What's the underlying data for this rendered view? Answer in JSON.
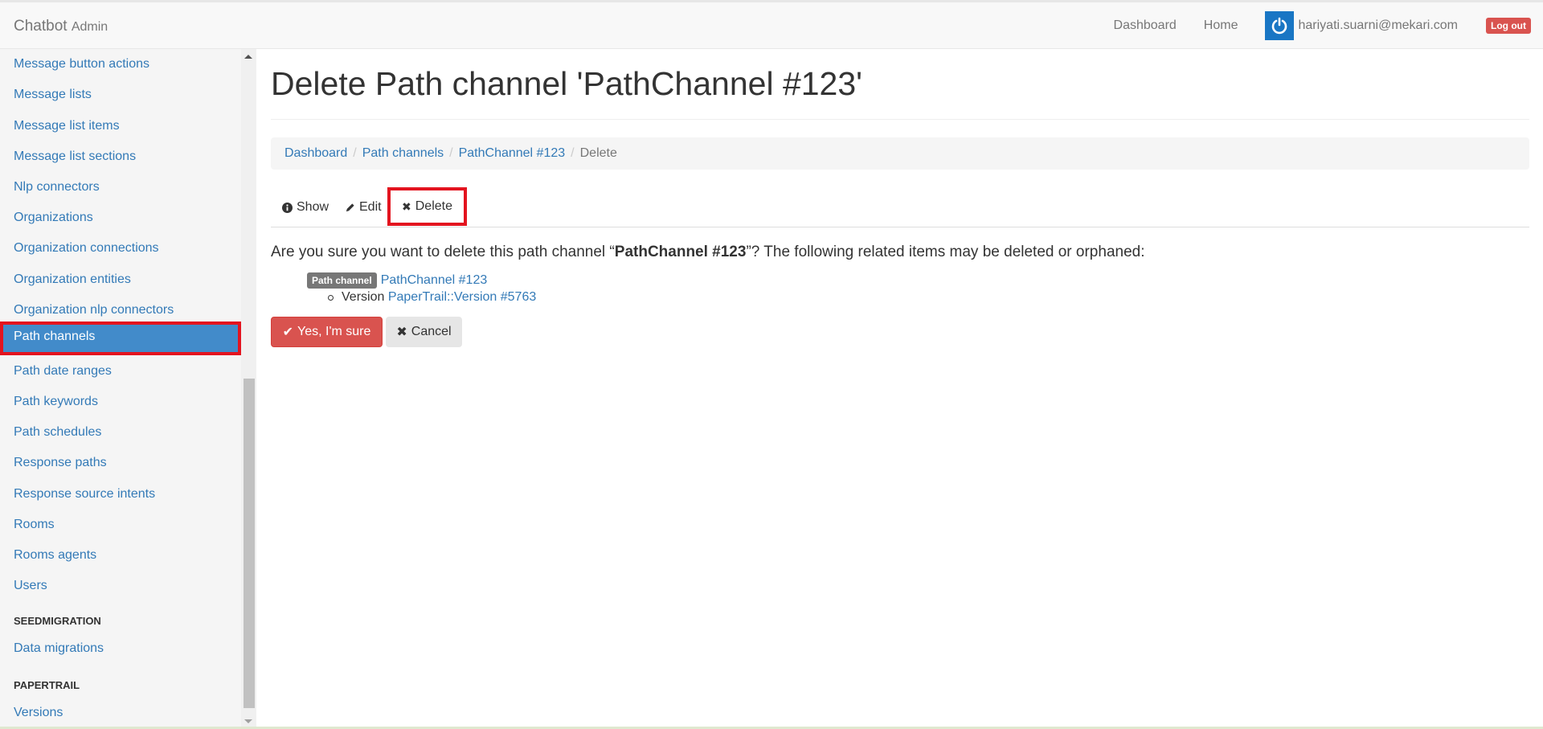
{
  "brand": {
    "name": "Chatbot",
    "sub": "Admin"
  },
  "nav": {
    "dashboard": "Dashboard",
    "home": "Home",
    "user_email": "hariyati.suarni@mekari.com",
    "logout": "Log out"
  },
  "sidebar": {
    "items": [
      {
        "label": "Message button actions"
      },
      {
        "label": "Message lists"
      },
      {
        "label": "Message list items"
      },
      {
        "label": "Message list sections"
      },
      {
        "label": "Nlp connectors"
      },
      {
        "label": "Organizations"
      },
      {
        "label": "Organization connections"
      },
      {
        "label": "Organization entities"
      },
      {
        "label": "Organization nlp connectors"
      },
      {
        "label": "Path channels",
        "active": true
      },
      {
        "label": "Path date ranges"
      },
      {
        "label": "Path keywords"
      },
      {
        "label": "Path schedules"
      },
      {
        "label": "Response paths"
      },
      {
        "label": "Response source intents"
      },
      {
        "label": "Rooms"
      },
      {
        "label": "Rooms agents"
      },
      {
        "label": "Users"
      }
    ],
    "section_seed": "SEEDMIGRATION",
    "data_migrations": "Data migrations",
    "section_papertrail": "PAPERTRAIL",
    "versions": "Versions"
  },
  "main": {
    "title": "Delete Path channel 'PathChannel #123'",
    "breadcrumb": [
      "Dashboard",
      "Path channels",
      "PathChannel #123",
      "Delete"
    ],
    "tabs": {
      "show": "Show",
      "edit": "Edit",
      "delete": "Delete"
    },
    "confirm_prefix": "Are you sure you want to delete this path channel “",
    "confirm_name": "PathChannel #123",
    "confirm_suffix": "”? The following related items may be deleted or orphaned:",
    "related": {
      "badge": "Path channel",
      "link": "PathChannel #123",
      "sub_label": "Version",
      "sub_link": "PaperTrail::Version #5763"
    },
    "yes_button": "Yes, I'm sure",
    "cancel_button": "Cancel"
  },
  "colors": {
    "accent": "#337ab7",
    "active_bg": "#428bca",
    "danger": "#d9534f",
    "highlight": "#e3141f"
  }
}
